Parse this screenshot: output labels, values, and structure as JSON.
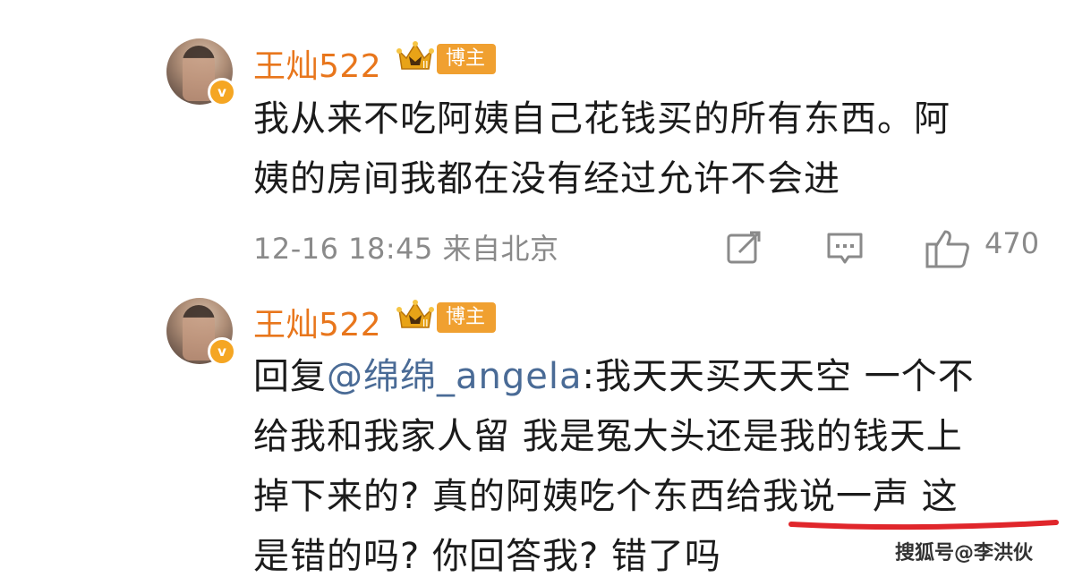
{
  "comments": [
    {
      "username": "王灿522",
      "badge": "博主",
      "crown_level": "II",
      "verified_mark": "v",
      "lines": [
        "我从来不吃阿姨自己花钱买的所有东西。阿",
        "姨的房间我都在没有经过允许不会进"
      ],
      "meta": "12-16 18:45 来自北京",
      "like_count": "470"
    },
    {
      "username": "王灿522",
      "badge": "博主",
      "crown_level": "II",
      "verified_mark": "v",
      "reply_prefix": "回复",
      "mention": "@绵绵_angela",
      "line1_rest": ":我天天买天天空 一个不",
      "line2": "给我和我家人留 我是冤大头还是我的钱天上",
      "line3": "掉下来的? 真的阿姨吃个东西给我说一声 这",
      "line4": "是错的吗? 你回答我? 错了吗"
    }
  ],
  "watermark": "搜狐号@李洪伙",
  "colors": {
    "username": "#e8761c",
    "badge": "#f0a030",
    "mention": "#4a6b96",
    "meta": "#8a8a8a",
    "underline": "#e0262b"
  },
  "icons": [
    "share-icon",
    "comment-icon",
    "like-icon"
  ]
}
